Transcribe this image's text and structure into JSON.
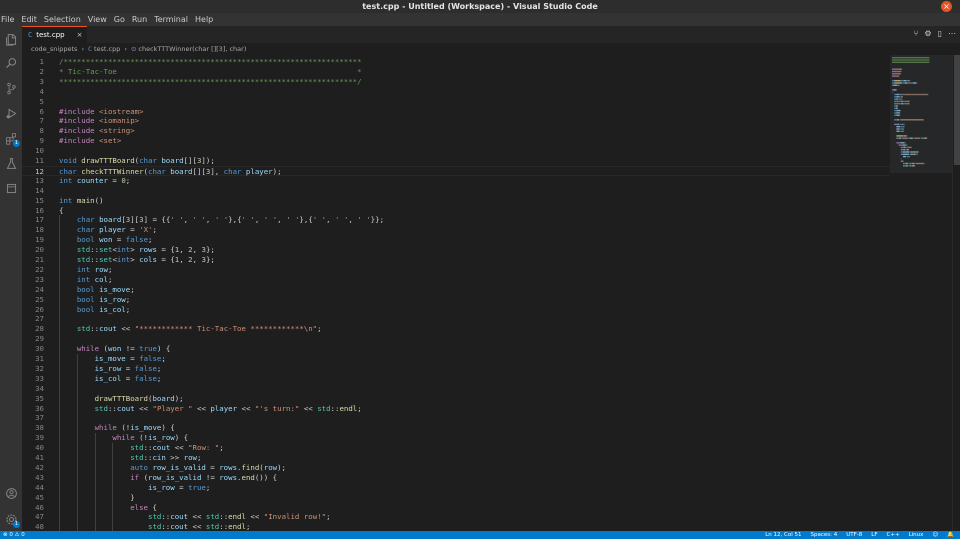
{
  "window": {
    "title": "test.cpp - Untitled (Workspace) - Visual Studio Code",
    "close_glyph": "×"
  },
  "menu": [
    "File",
    "Edit",
    "Selection",
    "View",
    "Go",
    "Run",
    "Terminal",
    "Help"
  ],
  "activity_bar": {
    "top": [
      "explorer-icon",
      "search-icon",
      "source-control-icon",
      "run-debug-icon",
      "extensions-icon",
      "testing-icon",
      "remote-explorer-icon"
    ],
    "bottom": [
      "account-icon",
      "manage-gear-icon"
    ],
    "extensions_badge": "1",
    "gear_badge": "1"
  },
  "tab": {
    "label": "test.cpp",
    "file_icon": "C",
    "close": "×"
  },
  "tab_actions": [
    "⑂",
    "⚙",
    "▯",
    "⋯"
  ],
  "breadcrumb": {
    "folder": "code_snippets",
    "file": "test.cpp",
    "symbol": "checkTTTWinner(char [][3], char)"
  },
  "editor": {
    "current_line": 12,
    "lines": [
      {
        "n": "1",
        "t": [
          [
            "c",
            "/*******************************************************************"
          ]
        ]
      },
      {
        "n": "2",
        "t": [
          [
            "c",
            "* Tic-Tac-Toe                                                      *"
          ]
        ]
      },
      {
        "n": "3",
        "t": [
          [
            "c",
            "*******************************************************************/"
          ]
        ]
      },
      {
        "n": "4",
        "t": []
      },
      {
        "n": "5",
        "t": []
      },
      {
        "n": "6",
        "t": [
          [
            "p",
            "#include "
          ],
          [
            "s",
            "<iostream>"
          ]
        ]
      },
      {
        "n": "7",
        "t": [
          [
            "p",
            "#include "
          ],
          [
            "s",
            "<iomanip>"
          ]
        ]
      },
      {
        "n": "8",
        "t": [
          [
            "p",
            "#include "
          ],
          [
            "s",
            "<string>"
          ]
        ]
      },
      {
        "n": "9",
        "t": [
          [
            "p",
            "#include "
          ],
          [
            "s",
            "<set>"
          ]
        ]
      },
      {
        "n": "10",
        "t": []
      },
      {
        "n": "11",
        "t": [
          [
            "k",
            "void "
          ],
          [
            "f",
            "drawTTTBoard"
          ],
          [
            "d",
            "("
          ],
          [
            "k",
            "char "
          ],
          [
            "v",
            "board"
          ],
          [
            "d",
            "[]["
          ],
          [
            "n",
            "3"
          ],
          [
            "d",
            "]);"
          ]
        ]
      },
      {
        "n": "12",
        "t": [
          [
            "k",
            "char "
          ],
          [
            "f",
            "checkTTTWinner"
          ],
          [
            "d",
            "("
          ],
          [
            "k",
            "char "
          ],
          [
            "v",
            "board"
          ],
          [
            "d",
            "[]["
          ],
          [
            "n",
            "3"
          ],
          [
            "d",
            "], "
          ],
          [
            "k",
            "char "
          ],
          [
            "v",
            "player"
          ],
          [
            "d",
            ");"
          ]
        ]
      },
      {
        "n": "13",
        "t": [
          [
            "k",
            "int "
          ],
          [
            "v",
            "counter"
          ],
          [
            "d",
            " = "
          ],
          [
            "n",
            "0"
          ],
          [
            "d",
            ";"
          ]
        ]
      },
      {
        "n": "14",
        "t": []
      },
      {
        "n": "15",
        "t": [
          [
            "k",
            "int "
          ],
          [
            "f",
            "main"
          ],
          [
            "d",
            "()"
          ]
        ]
      },
      {
        "n": "16",
        "t": [
          [
            "d",
            "{"
          ]
        ]
      },
      {
        "n": "17",
        "t": [
          [
            "d",
            "    "
          ],
          [
            "k",
            "char "
          ],
          [
            "v",
            "board"
          ],
          [
            "d",
            "["
          ],
          [
            "n",
            "3"
          ],
          [
            "d",
            "]["
          ],
          [
            "n",
            "3"
          ],
          [
            "d",
            "] = {{"
          ],
          [
            "s",
            "' '"
          ],
          [
            "d",
            ", "
          ],
          [
            "s",
            "' '"
          ],
          [
            "d",
            ", "
          ],
          [
            "s",
            "' '"
          ],
          [
            "d",
            "},{"
          ],
          [
            "s",
            "' '"
          ],
          [
            "d",
            ", "
          ],
          [
            "s",
            "' '"
          ],
          [
            "d",
            ", "
          ],
          [
            "s",
            "' '"
          ],
          [
            "d",
            "},{"
          ],
          [
            "s",
            "' '"
          ],
          [
            "d",
            ", "
          ],
          [
            "s",
            "' '"
          ],
          [
            "d",
            ", "
          ],
          [
            "s",
            "' '"
          ],
          [
            "d",
            "}};"
          ]
        ]
      },
      {
        "n": "18",
        "t": [
          [
            "d",
            "    "
          ],
          [
            "k",
            "char "
          ],
          [
            "v",
            "player"
          ],
          [
            "d",
            " = "
          ],
          [
            "s",
            "'X'"
          ],
          [
            "d",
            ";"
          ]
        ]
      },
      {
        "n": "19",
        "t": [
          [
            "d",
            "    "
          ],
          [
            "k",
            "bool "
          ],
          [
            "v",
            "won"
          ],
          [
            "d",
            " = "
          ],
          [
            "k",
            "false"
          ],
          [
            "d",
            ";"
          ]
        ]
      },
      {
        "n": "20",
        "t": [
          [
            "d",
            "    "
          ],
          [
            "t",
            "std"
          ],
          [
            "d",
            "::"
          ],
          [
            "t",
            "set"
          ],
          [
            "d",
            "<"
          ],
          [
            "k",
            "int"
          ],
          [
            "d",
            "> "
          ],
          [
            "v",
            "rows"
          ],
          [
            "d",
            " = {"
          ],
          [
            "n",
            "1"
          ],
          [
            "d",
            ", "
          ],
          [
            "n",
            "2"
          ],
          [
            "d",
            ", "
          ],
          [
            "n",
            "3"
          ],
          [
            "d",
            "};"
          ]
        ]
      },
      {
        "n": "21",
        "t": [
          [
            "d",
            "    "
          ],
          [
            "t",
            "std"
          ],
          [
            "d",
            "::"
          ],
          [
            "t",
            "set"
          ],
          [
            "d",
            "<"
          ],
          [
            "k",
            "int"
          ],
          [
            "d",
            "> "
          ],
          [
            "v",
            "cols"
          ],
          [
            "d",
            " = {"
          ],
          [
            "n",
            "1"
          ],
          [
            "d",
            ", "
          ],
          [
            "n",
            "2"
          ],
          [
            "d",
            ", "
          ],
          [
            "n",
            "3"
          ],
          [
            "d",
            "};"
          ]
        ]
      },
      {
        "n": "22",
        "t": [
          [
            "d",
            "    "
          ],
          [
            "k",
            "int "
          ],
          [
            "v",
            "row"
          ],
          [
            "d",
            ";"
          ]
        ]
      },
      {
        "n": "23",
        "t": [
          [
            "d",
            "    "
          ],
          [
            "k",
            "int "
          ],
          [
            "v",
            "col"
          ],
          [
            "d",
            ";"
          ]
        ]
      },
      {
        "n": "24",
        "t": [
          [
            "d",
            "    "
          ],
          [
            "k",
            "bool "
          ],
          [
            "v",
            "is_move"
          ],
          [
            "d",
            ";"
          ]
        ]
      },
      {
        "n": "25",
        "t": [
          [
            "d",
            "    "
          ],
          [
            "k",
            "bool "
          ],
          [
            "v",
            "is_row"
          ],
          [
            "d",
            ";"
          ]
        ]
      },
      {
        "n": "26",
        "t": [
          [
            "d",
            "    "
          ],
          [
            "k",
            "bool "
          ],
          [
            "v",
            "is_col"
          ],
          [
            "d",
            ";"
          ]
        ]
      },
      {
        "n": "27",
        "t": []
      },
      {
        "n": "28",
        "t": [
          [
            "d",
            "    "
          ],
          [
            "t",
            "std"
          ],
          [
            "d",
            "::"
          ],
          [
            "v",
            "cout"
          ],
          [
            "d",
            " << "
          ],
          [
            "s",
            "\"************ Tic-Tac-Toe ************\\n\""
          ],
          [
            "d",
            ";"
          ]
        ]
      },
      {
        "n": "29",
        "t": []
      },
      {
        "n": "30",
        "t": [
          [
            "d",
            "    "
          ],
          [
            "p",
            "while "
          ],
          [
            "d",
            "("
          ],
          [
            "v",
            "won"
          ],
          [
            "d",
            " != "
          ],
          [
            "k",
            "true"
          ],
          [
            "d",
            ") {"
          ]
        ]
      },
      {
        "n": "31",
        "t": [
          [
            "d",
            "        "
          ],
          [
            "v",
            "is_move"
          ],
          [
            "d",
            " = "
          ],
          [
            "k",
            "false"
          ],
          [
            "d",
            ";"
          ]
        ]
      },
      {
        "n": "32",
        "t": [
          [
            "d",
            "        "
          ],
          [
            "v",
            "is_row"
          ],
          [
            "d",
            " = "
          ],
          [
            "k",
            "false"
          ],
          [
            "d",
            ";"
          ]
        ]
      },
      {
        "n": "33",
        "t": [
          [
            "d",
            "        "
          ],
          [
            "v",
            "is_col"
          ],
          [
            "d",
            " = "
          ],
          [
            "k",
            "false"
          ],
          [
            "d",
            ";"
          ]
        ]
      },
      {
        "n": "34",
        "t": []
      },
      {
        "n": "35",
        "t": [
          [
            "d",
            "        "
          ],
          [
            "f",
            "drawTTTBoard"
          ],
          [
            "d",
            "("
          ],
          [
            "v",
            "board"
          ],
          [
            "d",
            ");"
          ]
        ]
      },
      {
        "n": "36",
        "t": [
          [
            "d",
            "        "
          ],
          [
            "t",
            "std"
          ],
          [
            "d",
            "::"
          ],
          [
            "v",
            "cout"
          ],
          [
            "d",
            " << "
          ],
          [
            "s",
            "\"Player \""
          ],
          [
            "d",
            " << "
          ],
          [
            "v",
            "player"
          ],
          [
            "d",
            " << "
          ],
          [
            "s",
            "\"'s turn:\""
          ],
          [
            "d",
            " << "
          ],
          [
            "t",
            "std"
          ],
          [
            "d",
            "::"
          ],
          [
            "f",
            "endl"
          ],
          [
            "d",
            ";"
          ]
        ]
      },
      {
        "n": "37",
        "t": []
      },
      {
        "n": "38",
        "t": [
          [
            "d",
            "        "
          ],
          [
            "p",
            "while "
          ],
          [
            "d",
            "(!"
          ],
          [
            "v",
            "is_move"
          ],
          [
            "d",
            ") {"
          ]
        ]
      },
      {
        "n": "39",
        "t": [
          [
            "d",
            "            "
          ],
          [
            "p",
            "while "
          ],
          [
            "d",
            "(!"
          ],
          [
            "v",
            "is_row"
          ],
          [
            "d",
            ") {"
          ]
        ]
      },
      {
        "n": "40",
        "t": [
          [
            "d",
            "                "
          ],
          [
            "t",
            "std"
          ],
          [
            "d",
            "::"
          ],
          [
            "v",
            "cout"
          ],
          [
            "d",
            " << "
          ],
          [
            "s",
            "\"Row: \""
          ],
          [
            "d",
            ";"
          ]
        ]
      },
      {
        "n": "41",
        "t": [
          [
            "d",
            "                "
          ],
          [
            "t",
            "std"
          ],
          [
            "d",
            "::"
          ],
          [
            "v",
            "cin"
          ],
          [
            "d",
            " >> "
          ],
          [
            "v",
            "row"
          ],
          [
            "d",
            ";"
          ]
        ]
      },
      {
        "n": "42",
        "t": [
          [
            "d",
            "                "
          ],
          [
            "k",
            "auto "
          ],
          [
            "v",
            "row_is_valid"
          ],
          [
            "d",
            " = "
          ],
          [
            "v",
            "rows"
          ],
          [
            "d",
            "."
          ],
          [
            "f",
            "find"
          ],
          [
            "d",
            "("
          ],
          [
            "v",
            "row"
          ],
          [
            "d",
            ");"
          ]
        ]
      },
      {
        "n": "43",
        "t": [
          [
            "d",
            "                "
          ],
          [
            "p",
            "if "
          ],
          [
            "d",
            "("
          ],
          [
            "v",
            "row_is_valid"
          ],
          [
            "d",
            " != "
          ],
          [
            "v",
            "rows"
          ],
          [
            "d",
            "."
          ],
          [
            "f",
            "end"
          ],
          [
            "d",
            "()) {"
          ]
        ]
      },
      {
        "n": "44",
        "t": [
          [
            "d",
            "                    "
          ],
          [
            "v",
            "is_row"
          ],
          [
            "d",
            " = "
          ],
          [
            "k",
            "true"
          ],
          [
            "d",
            ";"
          ]
        ]
      },
      {
        "n": "45",
        "t": [
          [
            "d",
            "                }"
          ]
        ]
      },
      {
        "n": "46",
        "t": [
          [
            "d",
            "                "
          ],
          [
            "p",
            "else "
          ],
          [
            "d",
            "{"
          ]
        ]
      },
      {
        "n": "47",
        "t": [
          [
            "d",
            "                    "
          ],
          [
            "t",
            "std"
          ],
          [
            "d",
            "::"
          ],
          [
            "v",
            "cout"
          ],
          [
            "d",
            " << "
          ],
          [
            "t",
            "std"
          ],
          [
            "d",
            "::"
          ],
          [
            "f",
            "endl"
          ],
          [
            "d",
            " << "
          ],
          [
            "s",
            "\"Invalid row!\""
          ],
          [
            "d",
            ";"
          ]
        ]
      },
      {
        "n": "48",
        "t": [
          [
            "d",
            "                    "
          ],
          [
            "t",
            "std"
          ],
          [
            "d",
            "::"
          ],
          [
            "v",
            "cout"
          ],
          [
            "d",
            " << "
          ],
          [
            "t",
            "std"
          ],
          [
            "d",
            "::"
          ],
          [
            "f",
            "endl"
          ],
          [
            "d",
            ";"
          ]
        ]
      }
    ]
  },
  "status": {
    "left": "⊗ 0  ⚠ 0",
    "right": [
      "Ln 12, Col 51",
      "Spaces: 4",
      "UTF-8",
      "LF",
      "C++",
      "Linux",
      "☺",
      "🔔"
    ]
  },
  "colors": {
    "accent": "#007acc",
    "tab_border": "#e95420",
    "editor_bg": "#1e1e1e"
  }
}
